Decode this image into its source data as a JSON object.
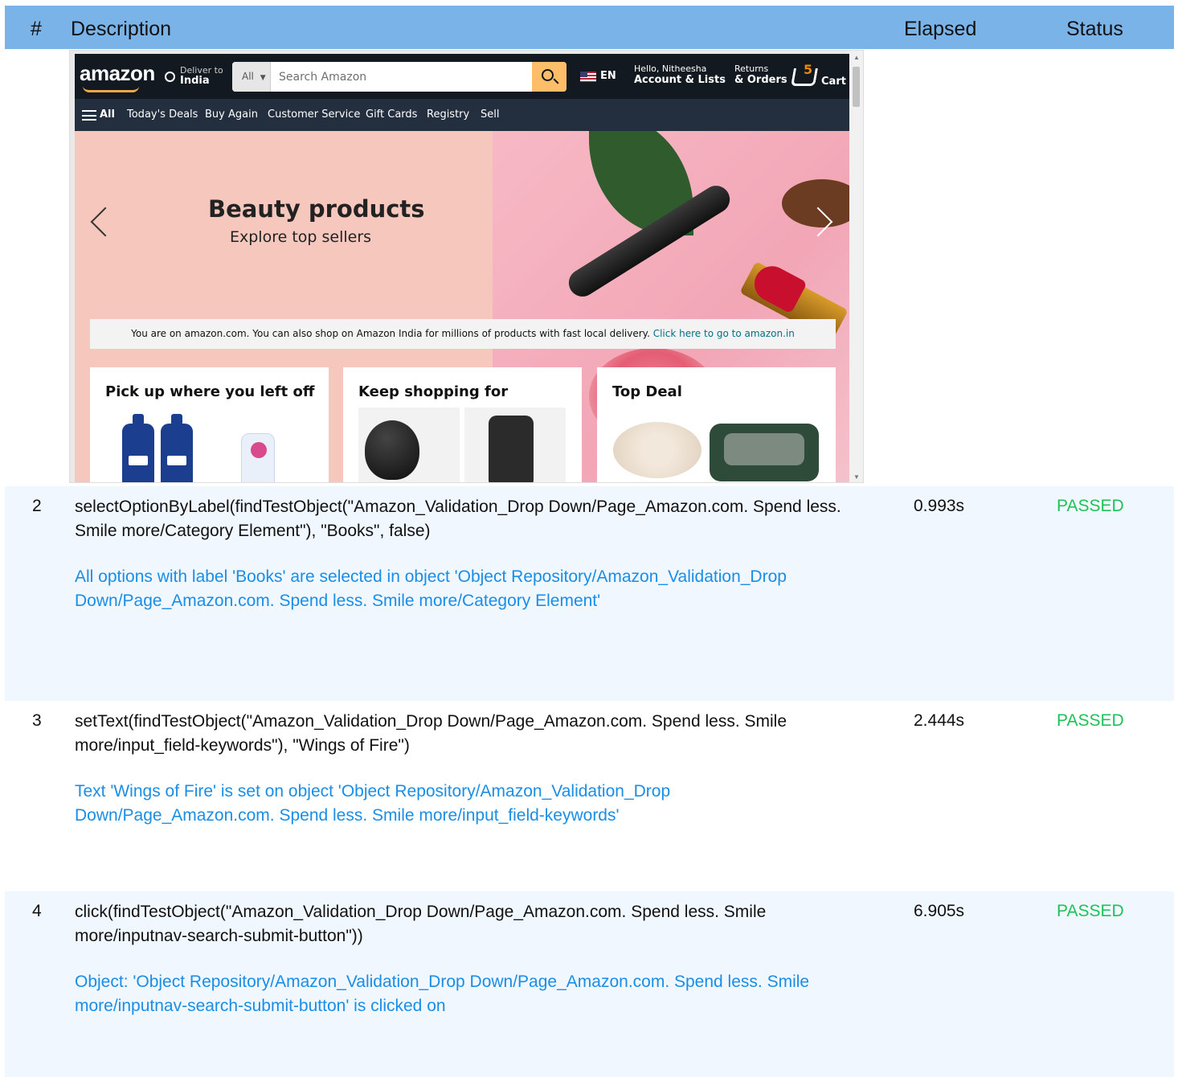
{
  "report": {
    "headers": {
      "number": "#",
      "description": "Description",
      "elapsed": "Elapsed",
      "status": "Status"
    },
    "rows": [
      {
        "number": "2",
        "description": "selectOptionByLabel(findTestObject(\"Amazon_Validation_Drop Down/Page_Amazon.com. Spend less. Smile more/Category Element\"), \"Books\", false)",
        "message": "All options with label 'Books' are selected in object 'Object Repository/Amazon_Validation_Drop Down/Page_Amazon.com. Spend less. Smile more/Category Element'",
        "elapsed": "0.993s",
        "status": "PASSED"
      },
      {
        "number": "3",
        "description": "setText(findTestObject(\"Amazon_Validation_Drop Down/Page_Amazon.com. Spend less. Smile more/input_field-keywords\"), \"Wings of Fire\")",
        "message": "Text 'Wings of Fire' is set on object 'Object Repository/Amazon_Validation_Drop Down/Page_Amazon.com. Spend less. Smile more/input_field-keywords'",
        "elapsed": "2.444s",
        "status": "PASSED"
      },
      {
        "number": "4",
        "description": "click(findTestObject(\"Amazon_Validation_Drop Down/Page_Amazon.com. Spend less. Smile more/inputnav-search-submit-button\"))",
        "message": "Object: 'Object Repository/Amazon_Validation_Drop Down/Page_Amazon.com. Spend less. Smile more/inputnav-search-submit-button' is clicked on",
        "elapsed": "6.905s",
        "status": "PASSED"
      }
    ]
  },
  "amazon": {
    "logo": "amazon",
    "deliver_to": "Deliver to",
    "location": "India",
    "search_category": "All",
    "search_placeholder": "Search Amazon",
    "language": "EN",
    "greeting": "Hello, Nitheesha",
    "account_lists": "Account & Lists",
    "returns": "Returns",
    "orders": "& Orders",
    "cart_count": "5",
    "cart_label": "Cart",
    "nav_items": [
      "All",
      "Today's Deals",
      "Buy Again",
      "Customer Service",
      "Gift Cards",
      "Registry",
      "Sell"
    ],
    "hero_title": "Beauty products",
    "hero_subtitle": "Explore top sellers",
    "notice_text": "You are on amazon.com. You can also shop on Amazon India for millions of products with fast local delivery.",
    "notice_link": "Click here to go to amazon.in",
    "cards": [
      {
        "title": "Pick up where you left off"
      },
      {
        "title": "Keep shopping for"
      },
      {
        "title": "Top Deal"
      }
    ]
  },
  "colors": {
    "header_bg": "#7ab3e8",
    "row_bg": "#f0f7ff",
    "message": "#1a8ee6",
    "passed": "#1ec25a",
    "amazon_nav": "#131921",
    "amazon_subnav": "#232f3e",
    "search_button": "#febd69"
  }
}
